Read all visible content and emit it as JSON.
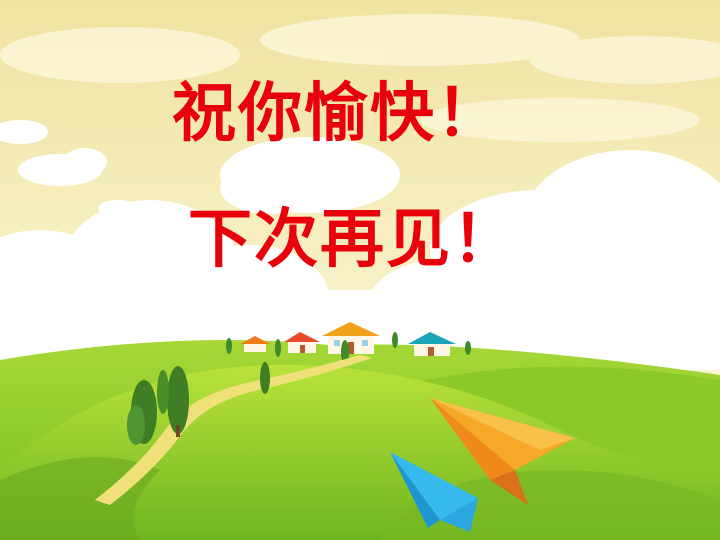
{
  "slide": {
    "line1": "祝你愉快！",
    "line2": "下次再见！"
  },
  "colors": {
    "text": "#e8000b",
    "sky_top": "#f2e8a8",
    "sky_bottom": "#fbf7d6",
    "hill_green": "#8fcf2a",
    "hill_dark": "#5fa21f",
    "path": "#efe07a",
    "plane_orange": "#f39a1e",
    "plane_blue": "#2fb6ea"
  },
  "icons": [
    "house-icon",
    "tree-icon",
    "cloud-icon",
    "paper-plane-icon"
  ]
}
